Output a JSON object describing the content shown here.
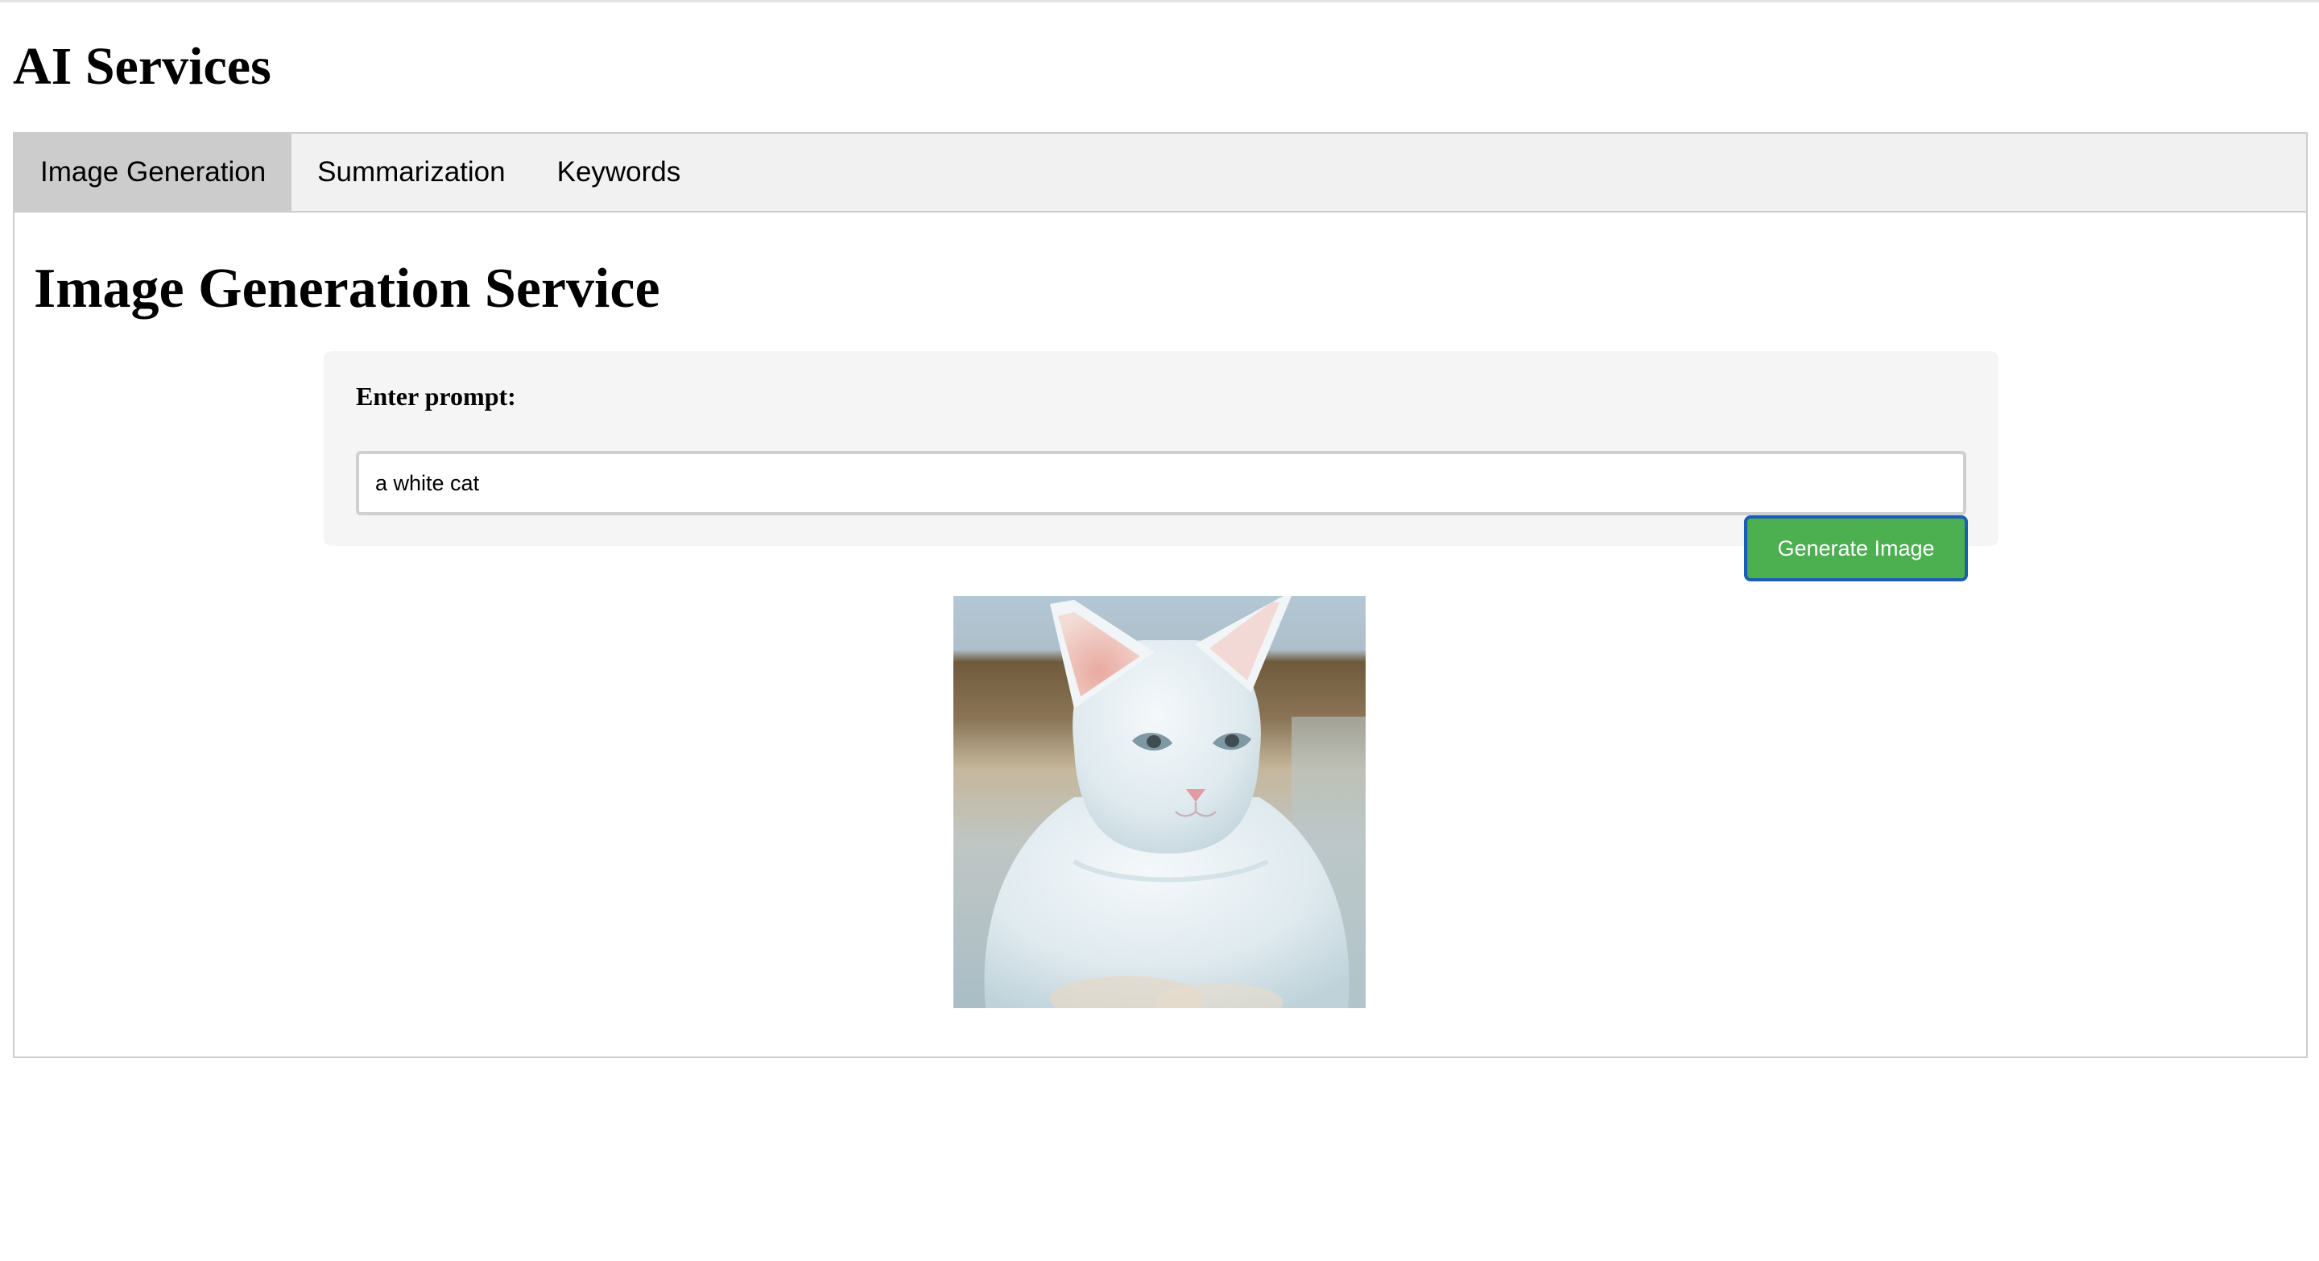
{
  "app": {
    "title": "AI Services"
  },
  "tabs": [
    {
      "label": "Image Generation",
      "active": true
    },
    {
      "label": "Summarization",
      "active": false
    },
    {
      "label": "Keywords",
      "active": false
    }
  ],
  "image_generation": {
    "title": "Image Generation Service",
    "prompt_label": "Enter prompt:",
    "prompt_value": "a white cat",
    "generate_button_label": "Generate Image",
    "result_image_subject": "white cat"
  },
  "colors": {
    "tab_bar_bg": "#f1f1f1",
    "active_tab_bg": "#cccccc",
    "button_bg": "#4caf50",
    "button_focus_border": "#1a5fb4",
    "card_bg": "#f5f5f5"
  }
}
